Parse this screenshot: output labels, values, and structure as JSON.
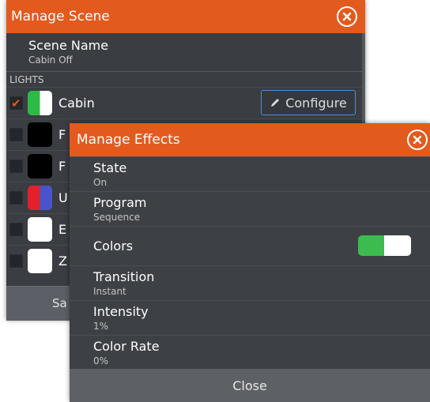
{
  "scene_dialog": {
    "title": "Manage Scene",
    "scene_name_label": "Scene Name",
    "scene_name_value": "Cabin Off",
    "section_header": "LIGHTS",
    "configure_label": "Configure",
    "save_label": "Sa",
    "lights": [
      {
        "label": "Cabin",
        "checked": true,
        "swatch": "green-white"
      },
      {
        "label": "F",
        "checked": false,
        "swatch": "black"
      },
      {
        "label": "F",
        "checked": false,
        "swatch": "black"
      },
      {
        "label": "U",
        "checked": false,
        "swatch": "red-blue"
      },
      {
        "label": "E",
        "checked": false,
        "swatch": "white"
      },
      {
        "label": "Z",
        "checked": false,
        "swatch": "white"
      }
    ]
  },
  "effects_dialog": {
    "title": "Manage Effects",
    "rows": [
      {
        "label": "State",
        "value": "On"
      },
      {
        "label": "Program",
        "value": "Sequence"
      },
      {
        "label": "Colors",
        "value": ""
      },
      {
        "label": "Transition",
        "value": "Instant"
      },
      {
        "label": "Intensity",
        "value": "1%"
      },
      {
        "label": "Color Rate",
        "value": "0%"
      }
    ],
    "colors_toggle_on": true,
    "close_label": "Close"
  },
  "colors": {
    "accent": "#e35a1e",
    "panel": "#3a3d42",
    "toggle_on": "#3cbb4e",
    "focus_border": "#4a90d9"
  }
}
